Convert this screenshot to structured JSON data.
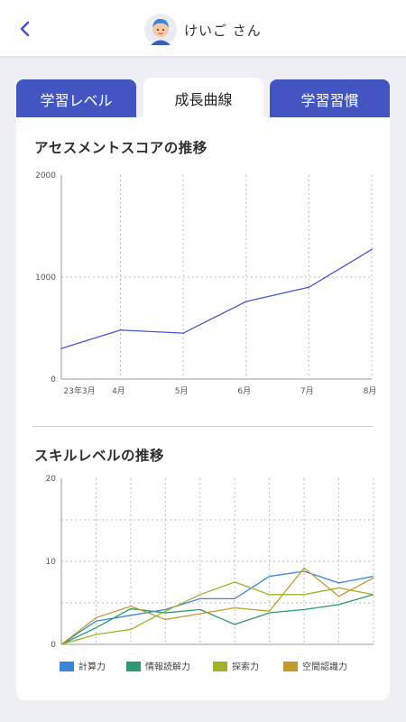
{
  "header": {
    "back_icon": "chevron-left-icon",
    "avatar_icon": "child-avatar-icon",
    "user_name": "けいご さん"
  },
  "tabs": [
    {
      "label": "学習レベル",
      "active": false
    },
    {
      "label": "成長曲線",
      "active": true
    },
    {
      "label": "学習習慣",
      "active": false
    }
  ],
  "sections": {
    "assessment_title": "アセスメントスコアの推移",
    "skill_title": "スキルレベルの推移"
  },
  "chart_data": [
    {
      "type": "line",
      "title": "アセスメントスコアの推移",
      "categories": [
        "23年3月",
        "4月",
        "5月",
        "6月",
        "7月",
        "8月"
      ],
      "x": [
        0,
        0.94,
        1.94,
        2.94,
        3.94,
        4.94
      ],
      "series": [
        {
          "values": [
            300,
            480,
            450,
            760,
            900,
            1270
          ],
          "color": "#4556c8"
        }
      ],
      "yticks": [
        "0",
        "1000",
        "2000"
      ],
      "ylim": [
        0,
        2000
      ],
      "grid": true
    },
    {
      "type": "line",
      "title": "スキルレベルの推移",
      "xpoints": 10,
      "yticks": [
        "0",
        "10",
        "20"
      ],
      "ylim": [
        0,
        20
      ],
      "grid": true,
      "legend_position": "bottom",
      "series": [
        {
          "name": "計算力",
          "color": "#3a86d6",
          "values": [
            0,
            2.8,
            3.5,
            4.2,
            5.5,
            5.5,
            8.2,
            8.8,
            7.4,
            8.2
          ]
        },
        {
          "name": "情報読解力",
          "color": "#2a9a73",
          "values": [
            0,
            2.0,
            4.3,
            3.8,
            4.2,
            2.4,
            3.8,
            4.2,
            4.8,
            6.0
          ]
        },
        {
          "name": "探索力",
          "color": "#9fb22a",
          "values": [
            0,
            1.2,
            1.8,
            4.0,
            6.0,
            7.5,
            6.0,
            6.0,
            6.8,
            6.0
          ]
        },
        {
          "name": "空間認識力",
          "color": "#c39a2c",
          "values": [
            0,
            3.2,
            4.6,
            3.0,
            3.7,
            4.4,
            4.0,
            9.2,
            5.8,
            8.0
          ]
        }
      ]
    }
  ]
}
